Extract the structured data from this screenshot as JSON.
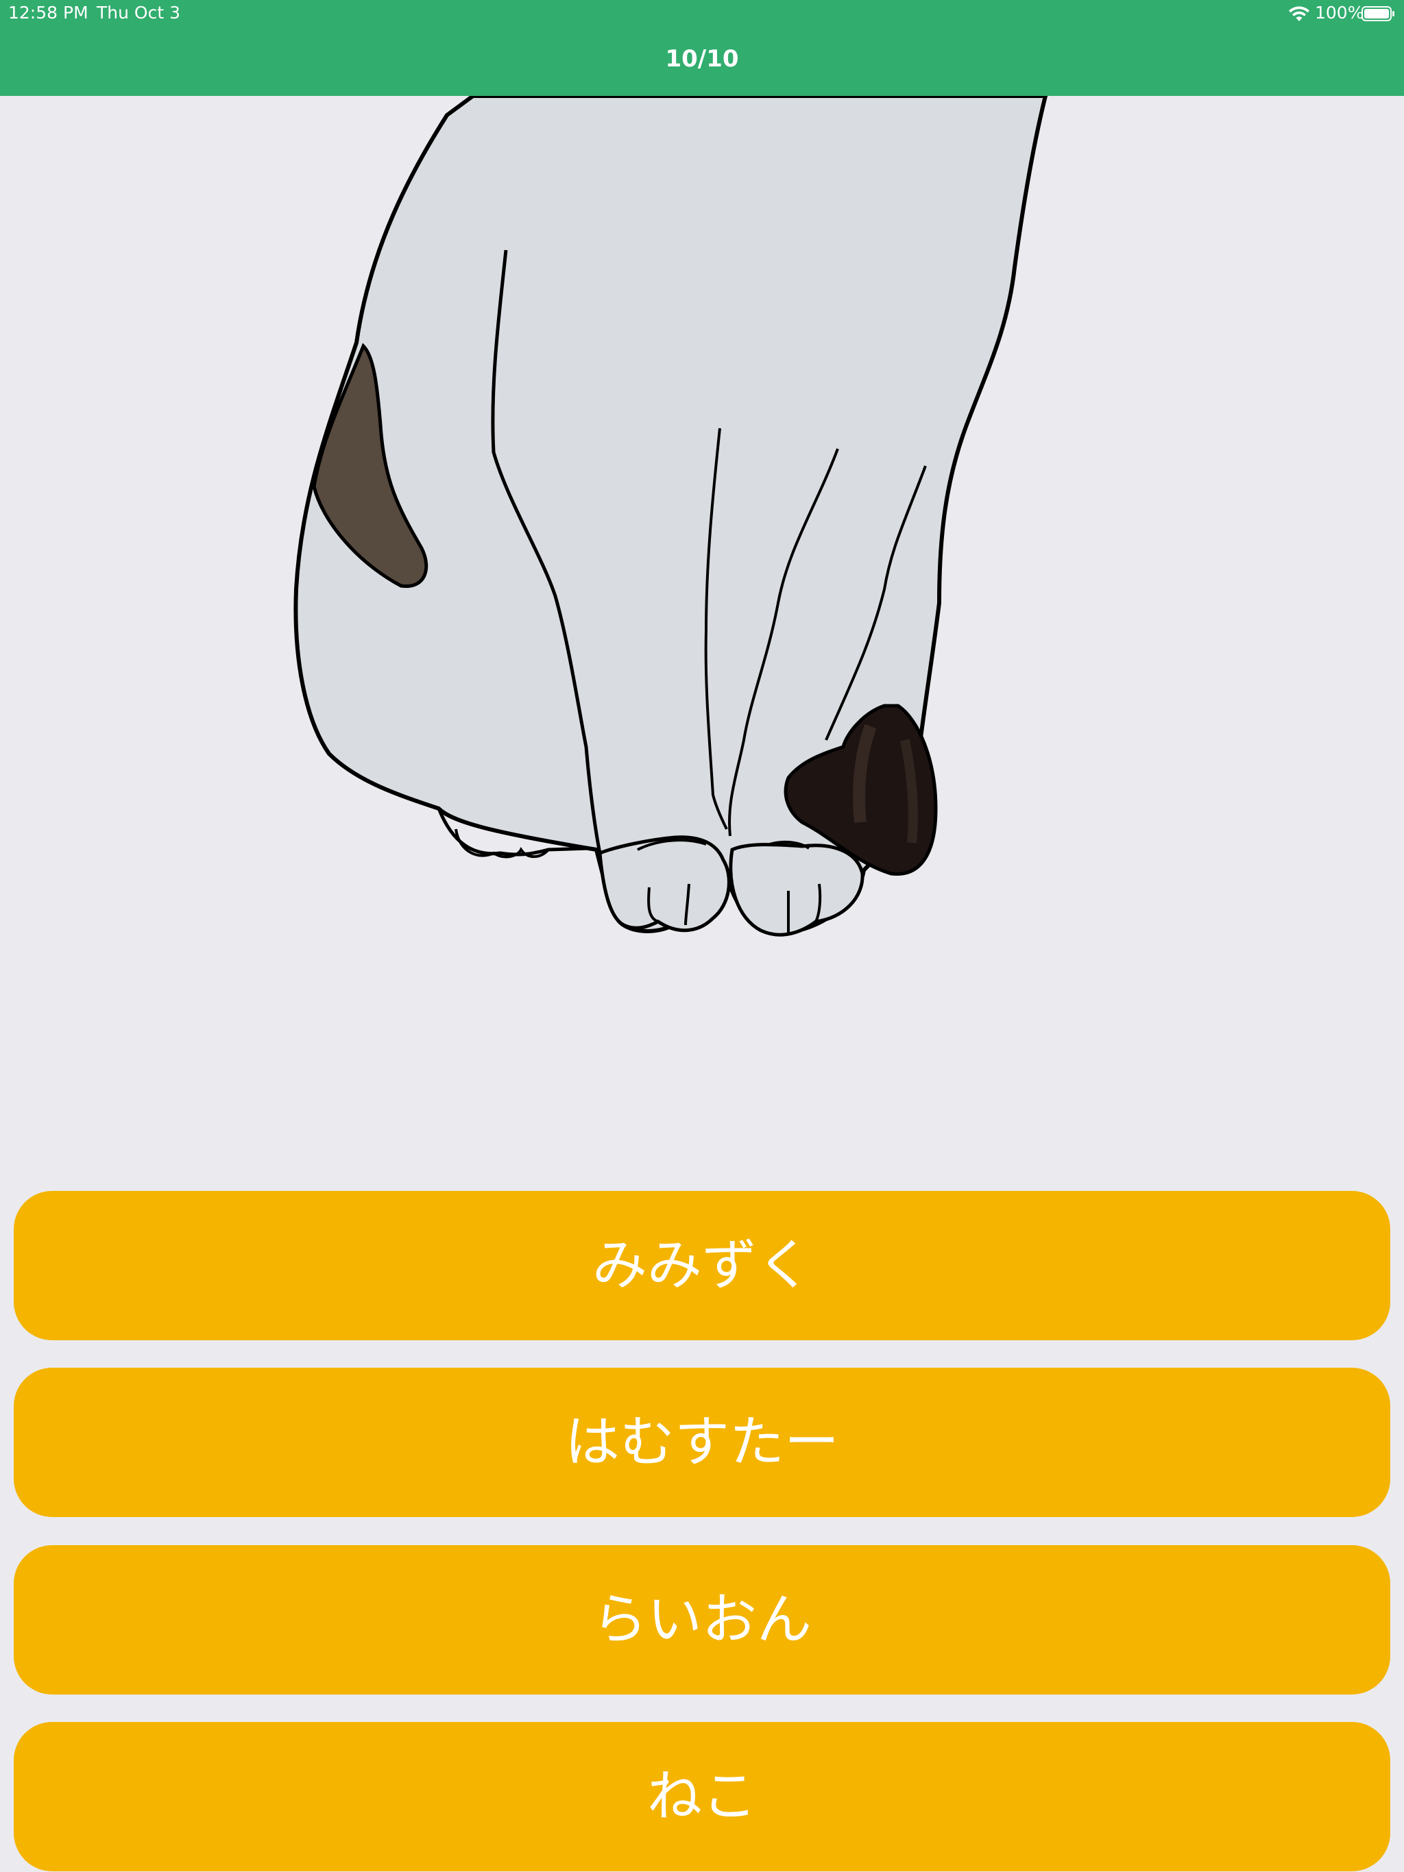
{
  "status_bar": {
    "time": "12:58 PM",
    "date": "Thu Oct 3",
    "battery": "100%",
    "wifi_icon": "wifi-icon",
    "battery_icon": "battery-icon"
  },
  "header": {
    "progress": "10/10",
    "background_color": "#31ad6e"
  },
  "illustration": {
    "icon": "cat-paws-illustration"
  },
  "answers": [
    {
      "label": "みみずく"
    },
    {
      "label": "はむすたー"
    },
    {
      "label": "らいおん"
    },
    {
      "label": "ねこ"
    }
  ],
  "colors": {
    "answer_button": "#f5b400",
    "background": "#ebebef"
  }
}
